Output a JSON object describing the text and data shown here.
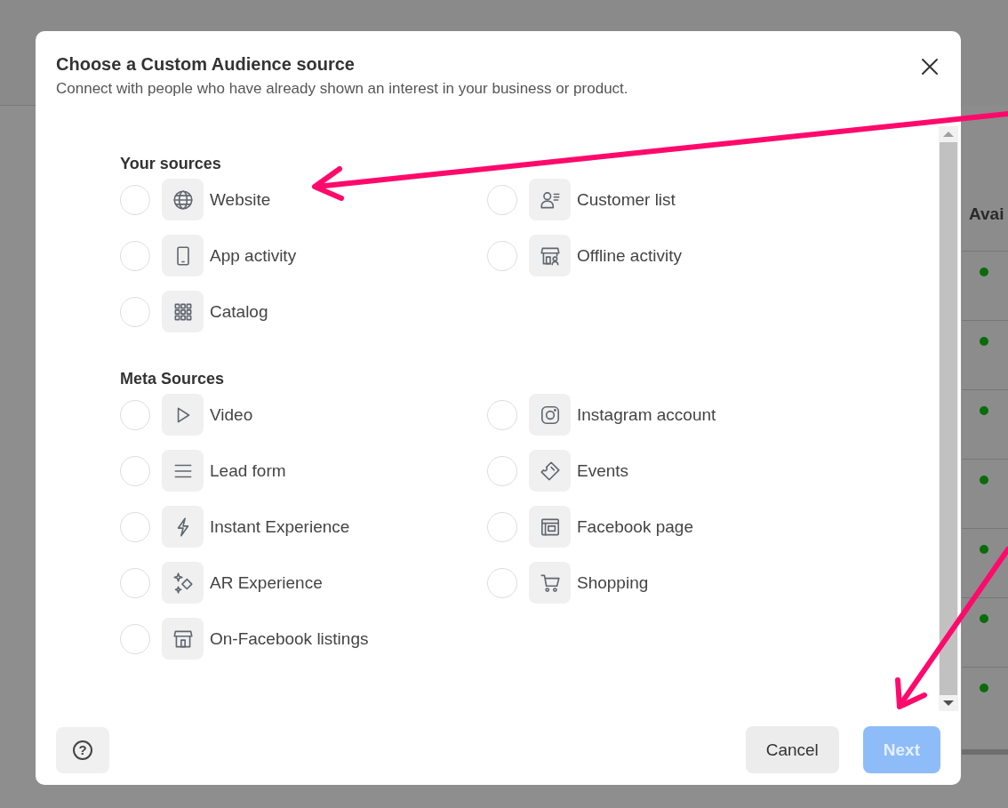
{
  "background": {
    "heading": "Avai",
    "rows": [
      {
        "kind": "dot"
      },
      {
        "kind": "dot"
      },
      {
        "kind": "dot"
      },
      {
        "kind": "dot"
      },
      {
        "kind": "dot"
      },
      {
        "kind": "dot"
      },
      {
        "kind": "dot"
      }
    ]
  },
  "dialog": {
    "title": "Choose a Custom Audience source",
    "subtitle": "Connect with people who have already shown an interest in your business or product.",
    "sections": [
      {
        "title": "Your sources",
        "items": [
          {
            "label": "Website",
            "kind": "globe",
            "selected": false
          },
          {
            "label": "Customer list",
            "kind": "person-list",
            "selected": false
          },
          {
            "label": "App activity",
            "kind": "phone",
            "selected": false
          },
          {
            "label": "Offline activity",
            "kind": "store-person",
            "selected": false
          },
          {
            "label": "Catalog",
            "kind": "grid",
            "selected": false
          }
        ]
      },
      {
        "title": "Meta Sources",
        "items": [
          {
            "label": "Video",
            "kind": "play",
            "selected": false
          },
          {
            "label": "Instagram account",
            "kind": "camera",
            "selected": false
          },
          {
            "label": "Lead form",
            "kind": "lines",
            "selected": false
          },
          {
            "label": "Events",
            "kind": "ticket",
            "selected": false
          },
          {
            "label": "Instant Experience",
            "kind": "bolt",
            "selected": false
          },
          {
            "label": "Facebook page",
            "kind": "page",
            "selected": false
          },
          {
            "label": "AR Experience",
            "kind": "sparkle",
            "selected": false
          },
          {
            "label": "Shopping",
            "kind": "cart",
            "selected": false
          },
          {
            "label": "On-Facebook listings",
            "kind": "store",
            "selected": false
          }
        ]
      }
    ],
    "help": {
      "glyph": "?"
    },
    "buttons": [
      {
        "label": "Cancel",
        "kind": "secondary",
        "disabled": false
      },
      {
        "label": "Next",
        "kind": "primary",
        "disabled": true
      }
    ]
  }
}
